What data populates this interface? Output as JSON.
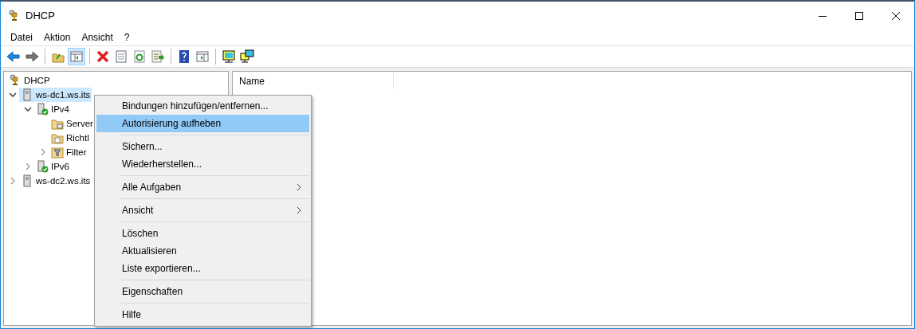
{
  "window": {
    "title": "DHCP"
  },
  "menu": [
    "Datei",
    "Aktion",
    "Ansicht",
    "?"
  ],
  "toolbar": [
    {
      "kind": "back",
      "selected": false
    },
    {
      "kind": "forward",
      "selected": false
    },
    {
      "kind": "sep"
    },
    {
      "kind": "up",
      "selected": false
    },
    {
      "kind": "tree",
      "selected": true
    },
    {
      "kind": "sep"
    },
    {
      "kind": "delete",
      "selected": false
    },
    {
      "kind": "properties",
      "selected": false
    },
    {
      "kind": "refresh",
      "selected": false
    },
    {
      "kind": "export",
      "selected": false
    },
    {
      "kind": "sep"
    },
    {
      "kind": "help",
      "selected": false
    },
    {
      "kind": "pane",
      "selected": false
    },
    {
      "kind": "sep"
    },
    {
      "kind": "monitor",
      "selected": false
    },
    {
      "kind": "monitors",
      "selected": false
    }
  ],
  "tree": [
    {
      "label": "DHCP",
      "kind": "root",
      "selected": false,
      "children": [
        {
          "label": "ws-dc1.ws.its",
          "kind": "server",
          "selected": true,
          "expanded": true,
          "children": [
            {
              "label": "IPv4",
              "kind": "protocol",
              "selected": false,
              "expanded": true,
              "children": [
                {
                  "label": "Server",
                  "kind": "folder",
                  "selected": false
                },
                {
                  "label": "Richtl",
                  "kind": "policy",
                  "selected": false
                },
                {
                  "label": "Filter",
                  "kind": "filter",
                  "selected": false,
                  "expanded": false
                }
              ]
            },
            {
              "label": "IPv6",
              "kind": "protocol",
              "selected": false,
              "expanded": false
            }
          ]
        },
        {
          "label": "ws-dc2.ws.its",
          "kind": "server",
          "selected": false,
          "expanded": false
        }
      ]
    }
  ],
  "list": {
    "columns": [
      "Name"
    ]
  },
  "context_menu": [
    [
      {
        "label": "Bindungen hinzufügen/entfernen...",
        "selected": false
      },
      {
        "label": "Autorisierung aufheben",
        "selected": true
      }
    ],
    [
      {
        "label": "Sichern...",
        "selected": false
      },
      {
        "label": "Wiederherstellen...",
        "selected": false
      }
    ],
    [
      {
        "label": "Alle Aufgaben",
        "selected": false,
        "submenu": true
      }
    ],
    [
      {
        "label": "Ansicht",
        "selected": false,
        "submenu": true
      }
    ],
    [
      {
        "label": "Löschen",
        "selected": false
      },
      {
        "label": "Aktualisieren",
        "selected": false
      },
      {
        "label": "Liste exportieren...",
        "selected": false
      }
    ],
    [
      {
        "label": "Eigenschaften",
        "selected": false
      }
    ],
    [
      {
        "label": "Hilfe",
        "selected": false
      }
    ]
  ]
}
